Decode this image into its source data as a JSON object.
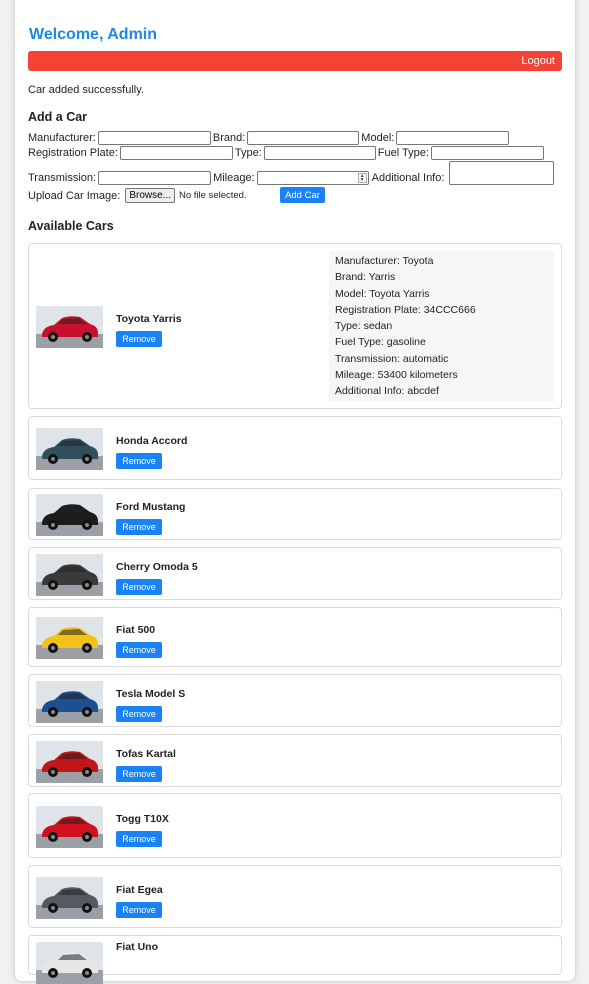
{
  "header": {
    "welcome": "Welcome, Admin",
    "logout_label": "Logout"
  },
  "status_message": "Car added successfully.",
  "form": {
    "title": "Add a Car",
    "manufacturer_label": "Manufacturer:",
    "brand_label": "Brand:",
    "model_label": "Model:",
    "plate_label": "Registration Plate:",
    "type_label": "Type:",
    "fuel_label": "Fuel Type:",
    "transmission_label": "Transmission:",
    "mileage_label": "Mileage:",
    "info_label": "Additional Info:",
    "image_label": "Upload Car Image:",
    "browse_label": "Browse...",
    "no_file_label": "No file selected.",
    "submit_label": "Add Car"
  },
  "cars_title": "Available Cars",
  "remove_label": "Remove",
  "selected_details": {
    "manufacturer": "Manufacturer: Toyota",
    "brand": "Brand: Yarris",
    "model": "Model: Toyota Yarris",
    "plate": "Registration Plate: 34CCC666",
    "type": "Type: sedan",
    "fuel": "Fuel Type: gasoline",
    "transmission": "Transmission: automatic",
    "mileage": "Mileage: 53400 kilometers",
    "info": "Additional Info: abcdef"
  },
  "cars": [
    {
      "name": "Toyota Yarris",
      "color": "#c8102e"
    },
    {
      "name": "Honda Accord",
      "color": "#2f4f5f"
    },
    {
      "name": "Ford Mustang",
      "color": "#1c1c1c"
    },
    {
      "name": "Cherry Omoda 5",
      "color": "#3a3a3a"
    },
    {
      "name": "Fiat 500",
      "color": "#f2c21a"
    },
    {
      "name": "Tesla Model S",
      "color": "#1d4f91"
    },
    {
      "name": "Tofas Kartal",
      "color": "#c0161c"
    },
    {
      "name": "Togg T10X",
      "color": "#d0101c"
    },
    {
      "name": "Fiat Egea",
      "color": "#555a60"
    },
    {
      "name": "Fiat Uno",
      "color": "#e7e7e7"
    }
  ],
  "colors": {
    "accent": "#1a82f7",
    "title": "#1e88e5",
    "logout": "#f44336"
  }
}
